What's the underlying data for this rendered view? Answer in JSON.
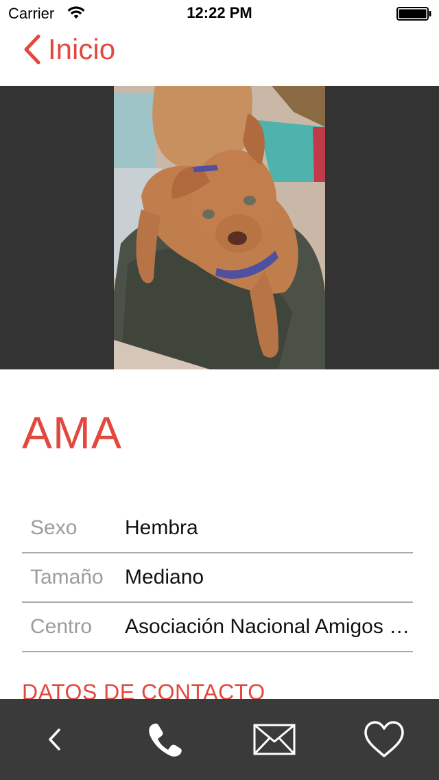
{
  "status_bar": {
    "carrier": "Carrier",
    "time": "12:22 PM"
  },
  "nav": {
    "back_label": "Inicio"
  },
  "photo": {
    "alt": "Foto de AMA"
  },
  "pet": {
    "name": "AMA"
  },
  "details": [
    {
      "label": "Sexo",
      "value": "Hembra"
    },
    {
      "label": "Tamaño",
      "value": "Mediano"
    },
    {
      "label": "Centro",
      "value": "Asociación Nacional Amigos de los Animales"
    }
  ],
  "contact_heading": "DATOS DE CONTACTO",
  "toolbar": {
    "icons": [
      "chevron-left-icon",
      "phone-icon",
      "mail-icon",
      "heart-icon"
    ]
  },
  "colors": {
    "accent": "#e2483d",
    "toolbar_bg": "#3a3a3a",
    "photo_bg": "#333333"
  }
}
